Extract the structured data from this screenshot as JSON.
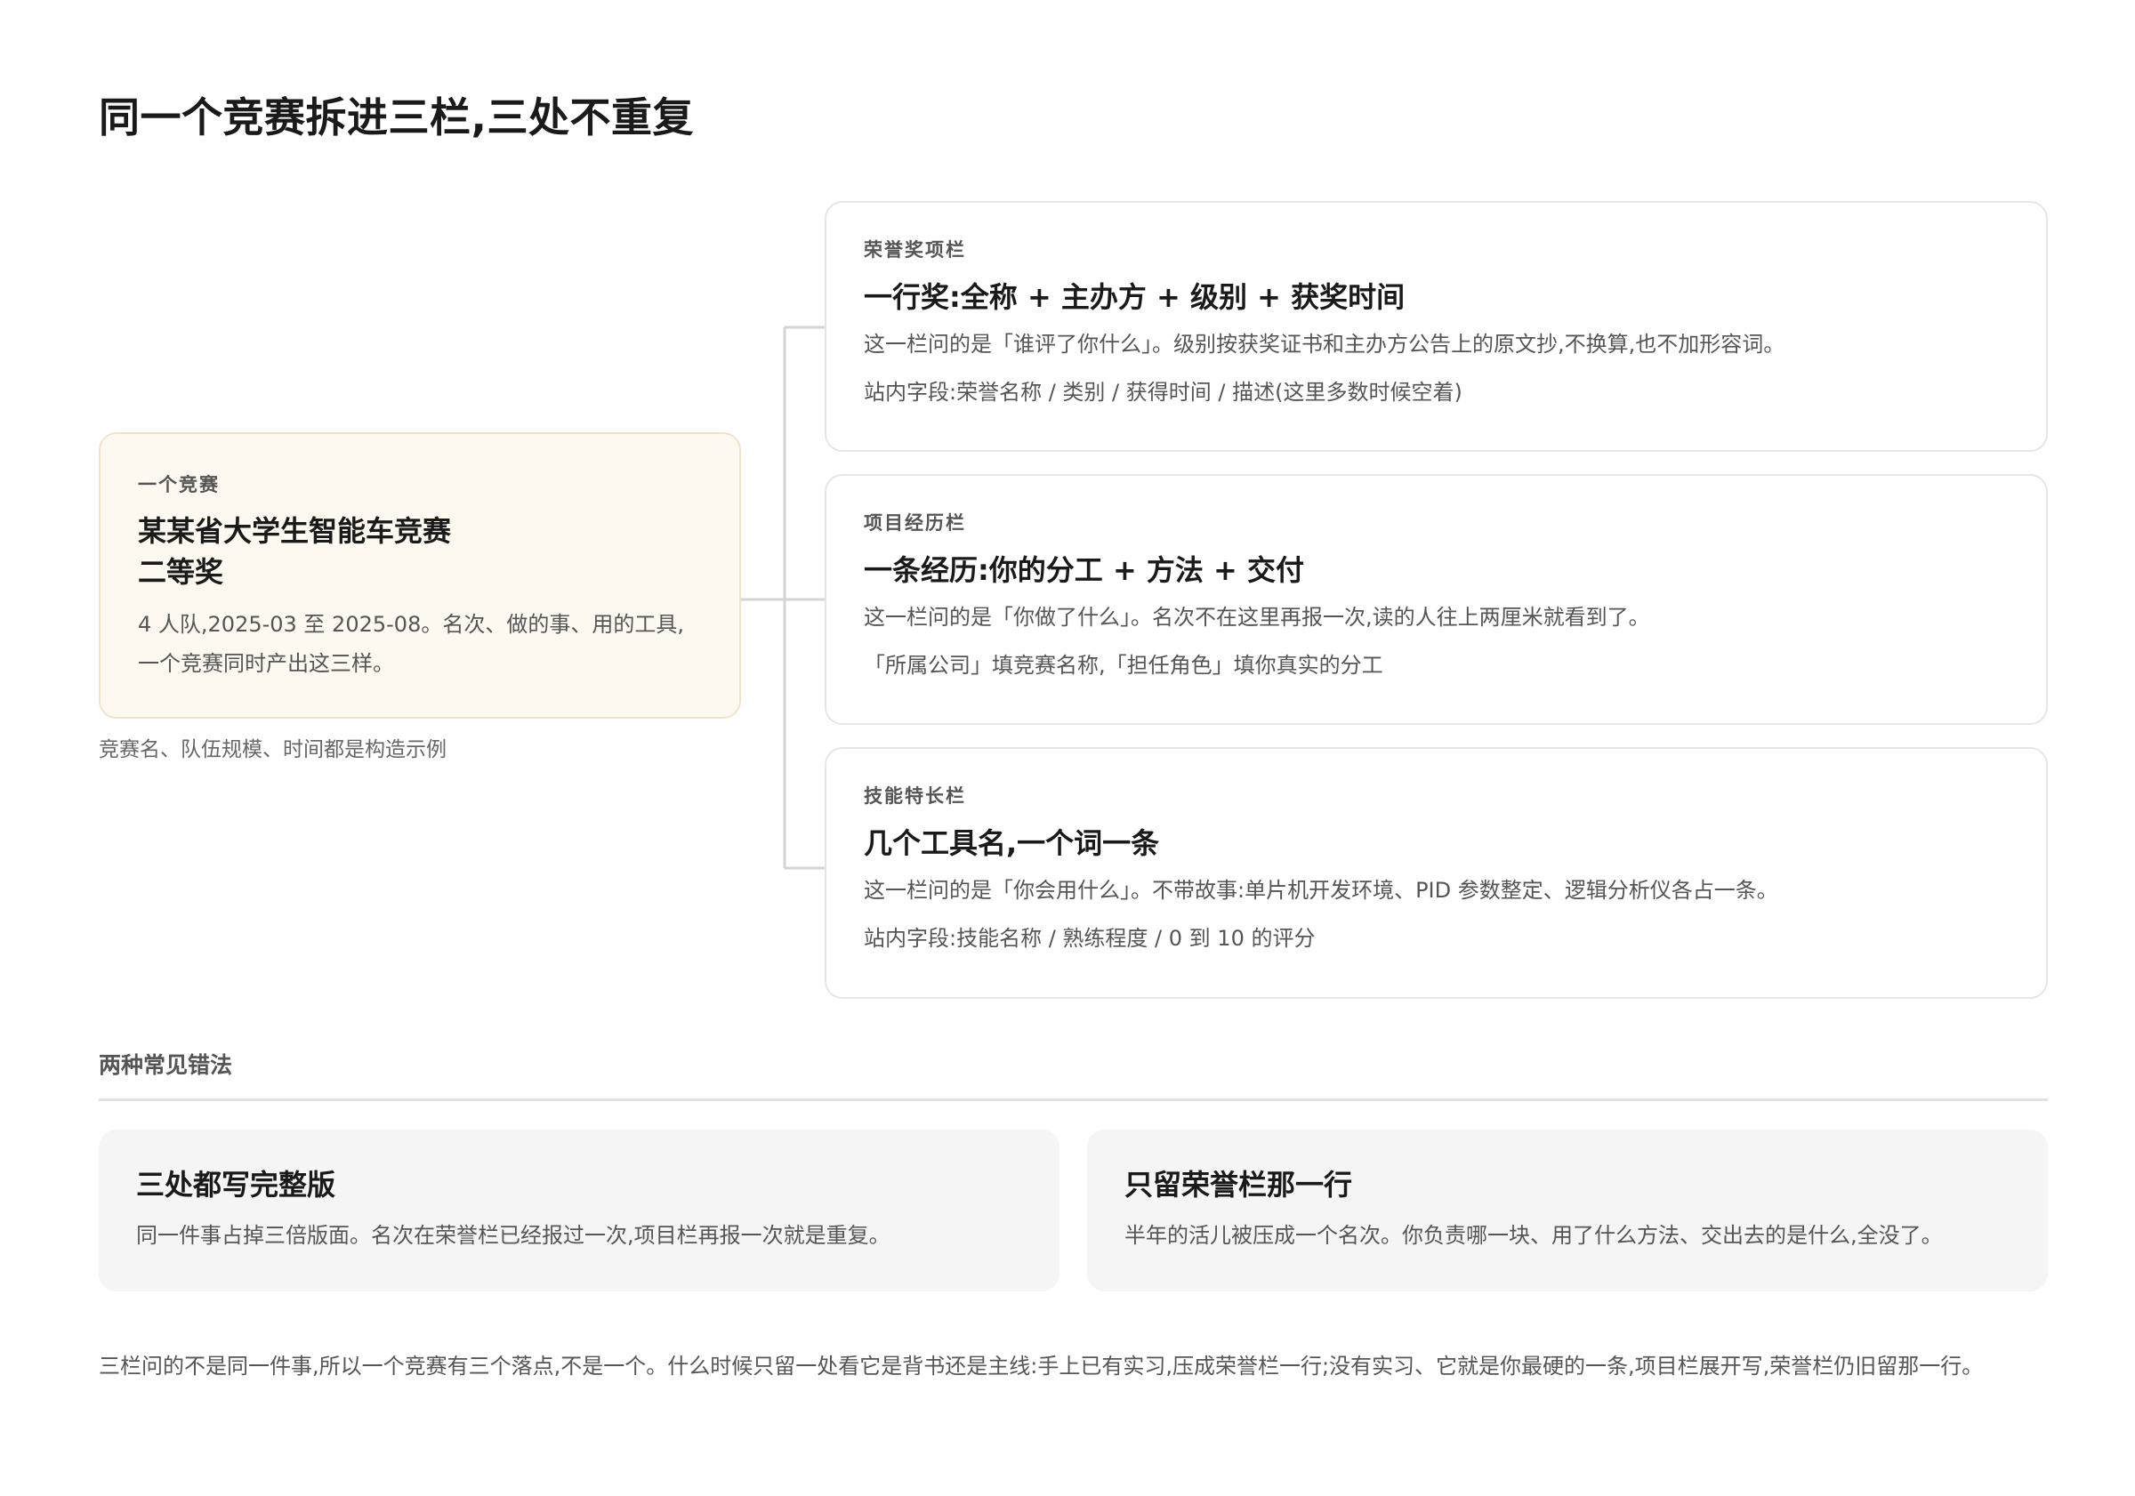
{
  "title": "同一个竞赛拆进三栏,三处不重复",
  "source": {
    "eyebrow": "一个竞赛",
    "title_line1": "某某省大学生智能车竞赛",
    "title_line2": "二等奖",
    "desc": "4 人队,2025-03 至 2025-08。名次、做的事、用的工具,一个竞赛同时产出这三样。",
    "note": "竞赛名、队伍规模、时间都是构造示例"
  },
  "columns": [
    {
      "eyebrow": "荣誉奖项栏",
      "title": "一行奖:全称 + 主办方 + 级别 + 获奖时间",
      "desc": "这一栏问的是「谁评了你什么」。级别按获奖证书和主办方公告上的原文抄,不换算,也不加形容词。",
      "field": "站内字段:荣誉名称 / 类别 / 获得时间 / 描述(这里多数时候空着)"
    },
    {
      "eyebrow": "项目经历栏",
      "title": "一条经历:你的分工 + 方法 + 交付",
      "desc": "这一栏问的是「你做了什么」。名次不在这里再报一次,读的人往上两厘米就看到了。",
      "field": "「所属公司」填竞赛名称,「担任角色」填你真实的分工"
    },
    {
      "eyebrow": "技能特长栏",
      "title": "几个工具名,一个词一条",
      "desc": "这一栏问的是「你会用什么」。不带故事:单片机开发环境、PID 参数整定、逻辑分析仪各占一条。",
      "field": "站内字段:技能名称 / 熟练程度 / 0 到 10 的评分"
    }
  ],
  "mistakes": {
    "label": "两种常见错法",
    "items": [
      {
        "title": "三处都写完整版",
        "desc": "同一件事占掉三倍版面。名次在荣誉栏已经报过一次,项目栏再报一次就是重复。"
      },
      {
        "title": "只留荣誉栏那一行",
        "desc": "半年的活儿被压成一个名次。你负责哪一块、用了什么方法、交出去的是什么,全没了。"
      }
    ]
  },
  "summary": "三栏问的不是同一件事,所以一个竞赛有三个落点,不是一个。什么时候只留一处看它是背书还是主线:手上已有实习,压成荣誉栏一行;没有实习、它就是你最硬的一条,项目栏展开写,荣誉栏仍旧留那一行。"
}
